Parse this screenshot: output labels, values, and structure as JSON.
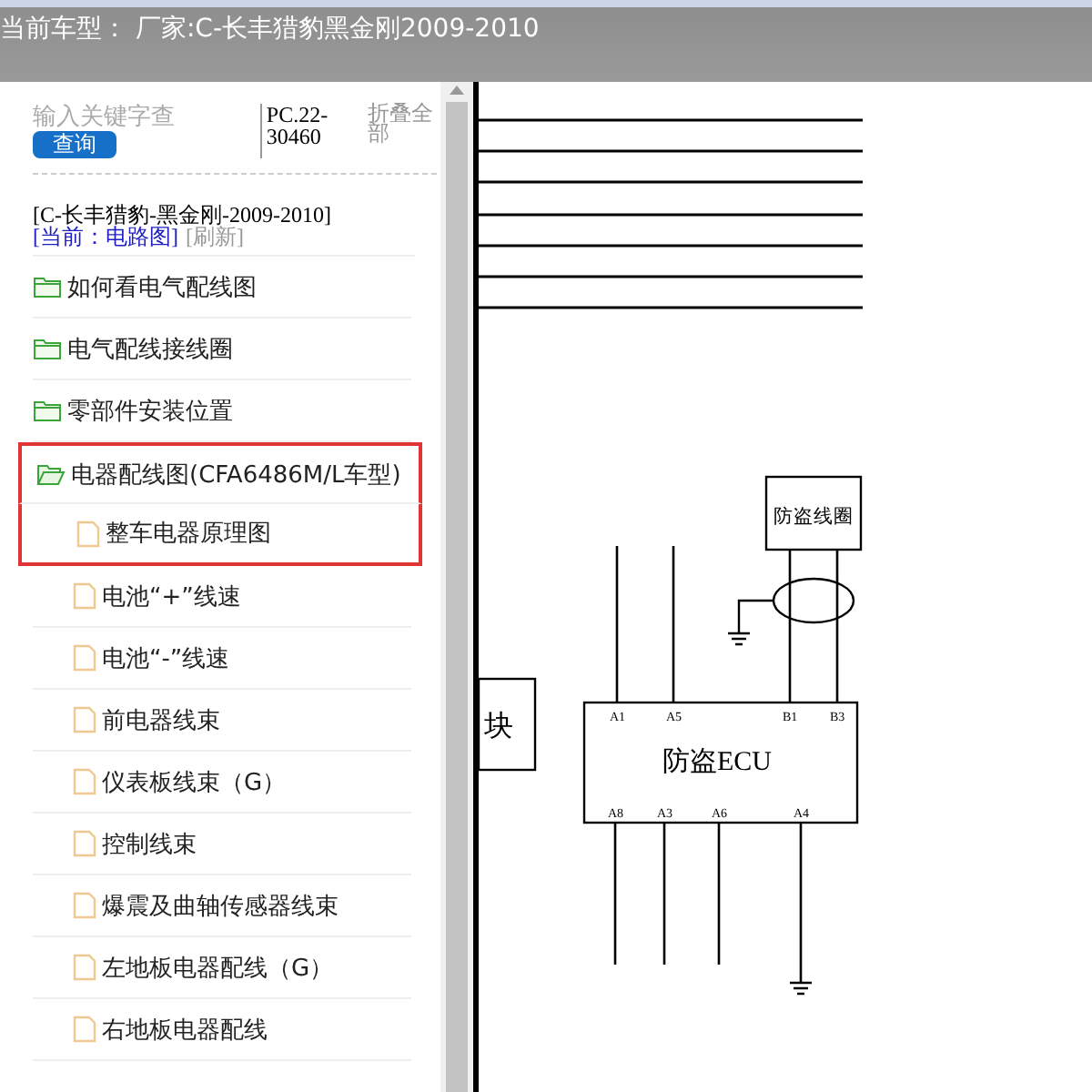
{
  "header": {
    "title": "当前车型： 厂家:C-长丰猎豹黑金刚2009-2010"
  },
  "search": {
    "placeholder": "输入关键字查",
    "button": "查询",
    "code": "PC.22-30460",
    "collapse": "折叠全部"
  },
  "breadcrumb": {
    "model": "[C-长丰猎豹-黑金刚-2009-2010]",
    "current": "[当前：电路图]",
    "refresh": "[刷新]"
  },
  "tree": [
    {
      "label": "如何看电气配线图",
      "expanded": false,
      "highlighted": false
    },
    {
      "label": "电气配线接线圈",
      "expanded": false,
      "highlighted": false
    },
    {
      "label": "零部件安装位置",
      "expanded": false,
      "highlighted": false
    },
    {
      "label": "电器配线图(CFA6486M/L车型)",
      "expanded": true,
      "highlighted": true,
      "children": [
        {
          "label": "整车电器原理图",
          "highlighted": true
        },
        {
          "label": "电池“+”线速",
          "highlighted": false
        },
        {
          "label": "电池“-”线速",
          "highlighted": false
        },
        {
          "label": "前电器线束",
          "highlighted": false
        },
        {
          "label": "仪表板线束（G）",
          "highlighted": false
        },
        {
          "label": "控制线束",
          "highlighted": false
        },
        {
          "label": "爆震及曲轴传感器线束",
          "highlighted": false
        },
        {
          "label": "左地板电器配线（G）",
          "highlighted": false
        },
        {
          "label": "右地板电器配线",
          "highlighted": false
        }
      ]
    }
  ],
  "diagram": {
    "module_label": "块",
    "coil_label": "防盗线圈",
    "ecu_label": "防盗ECU",
    "top_pins": [
      "A1",
      "A5",
      "B1",
      "B3"
    ],
    "bottom_pins": [
      "A8",
      "A3",
      "A6",
      "A4"
    ]
  }
}
